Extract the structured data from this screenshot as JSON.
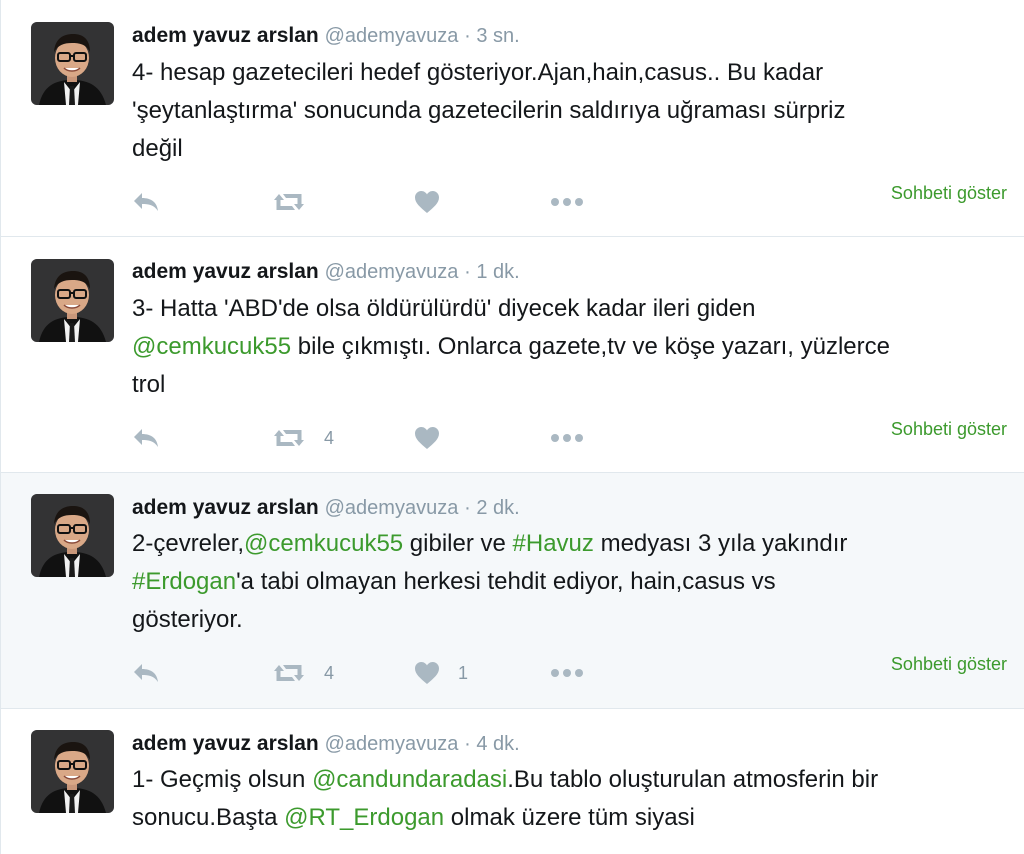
{
  "tweets": [
    {
      "author_name": "adem yavuz arslan",
      "handle": "@ademyavuza",
      "time": "· 3 sn.",
      "lines": [
        [
          {
            "t": "4- hesap gazetecileri hedef gösteriyor.Ajan,hain,casus.. Bu kadar"
          }
        ],
        [
          {
            "t": "'şeytanlaştırma' sonucunda gazetecilerin saldırıya uğraması sürpriz"
          }
        ],
        [
          {
            "t": "değil"
          }
        ]
      ],
      "retweets": "",
      "likes": "",
      "show_conversation": "Sohbeti göster"
    },
    {
      "author_name": "adem yavuz arslan",
      "handle": "@ademyavuza",
      "time": "· 1 dk.",
      "lines": [
        [
          {
            "t": "3- Hatta 'ABD'de olsa öldürülürdü' diyecek kadar ileri giden"
          }
        ],
        [
          {
            "t": "@cemkucuk55",
            "k": "mention"
          },
          {
            "t": " bile çıkmıştı. Onlarca gazete,tv ve köşe yazarı, yüzlerce"
          }
        ],
        [
          {
            "t": "trol"
          }
        ]
      ],
      "retweets": "4",
      "likes": "",
      "show_conversation": "Sohbeti göster"
    },
    {
      "author_name": "adem yavuz arslan",
      "handle": "@ademyavuza",
      "time": "· 2 dk.",
      "lines": [
        [
          {
            "t": "2-çevreler,"
          },
          {
            "t": "@cemkucuk55",
            "k": "mention"
          },
          {
            "t": " gibiler ve "
          },
          {
            "t": "#Havuz",
            "k": "hashtag"
          },
          {
            "t": " medyası 3 yıla yakındır"
          }
        ],
        [
          {
            "t": "#Erdogan",
            "k": "hashtag"
          },
          {
            "t": "'a tabi olmayan herkesi tehdit ediyor, hain,casus vs"
          }
        ],
        [
          {
            "t": "gösteriyor."
          }
        ]
      ],
      "retweets": "4",
      "likes": "1",
      "show_conversation": "Sohbeti göster"
    },
    {
      "author_name": "adem yavuz arslan",
      "handle": "@ademyavuza",
      "time": "· 4 dk.",
      "lines": [
        [
          {
            "t": "1- Geçmiş olsun "
          },
          {
            "t": "@candundaradasi",
            "k": "mention"
          },
          {
            "t": ".Bu tablo oluşturulan atmosferin bir"
          }
        ],
        [
          {
            "t": "sonucu.Başta "
          },
          {
            "t": "@RT_Erdogan",
            "k": "mention"
          },
          {
            "t": " olmak üzere tüm siyasi"
          }
        ]
      ],
      "retweets": "",
      "likes": "",
      "show_conversation": ""
    }
  ],
  "colors": {
    "link": "#3c9a2d",
    "muted": "#8899a6",
    "icon": "#aab8c2",
    "highlight_bg": "#f5f8fa"
  },
  "icons": [
    "reply-icon",
    "retweet-icon",
    "like-icon",
    "more-icon"
  ]
}
